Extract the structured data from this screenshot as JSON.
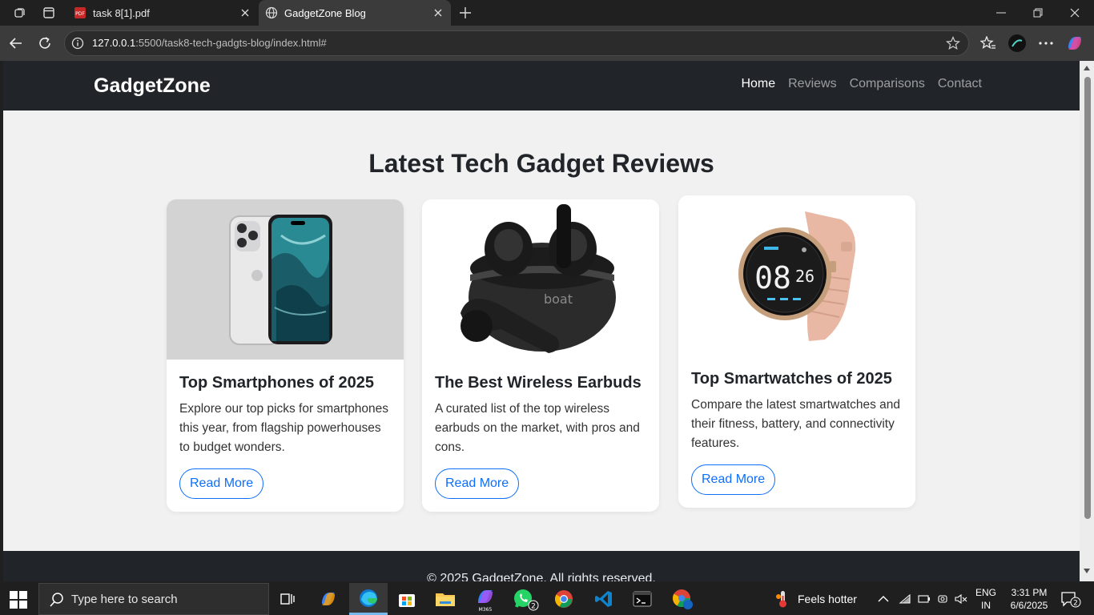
{
  "browser": {
    "tabs": [
      {
        "title": "task 8[1].pdf",
        "icon": "pdf-icon"
      },
      {
        "title": "GadgetZone Blog",
        "icon": "globe-icon",
        "active": true
      }
    ],
    "url": {
      "host": "127.0.0.1",
      "rest": ":5500/task8-tech-gadgts-blog/index.html#"
    }
  },
  "site": {
    "brand": "GadgetZone",
    "nav": [
      "Home",
      "Reviews",
      "Comparisons",
      "Contact"
    ],
    "heading": "Latest Tech Gadget Reviews",
    "cards": [
      {
        "title": "Top Smartphones of 2025",
        "text": "Explore our top picks for smartphones this year, from flagship powerhouses to budget wonders.",
        "button": "Read More"
      },
      {
        "title": "The Best Wireless Earbuds",
        "text": "A curated list of the top wireless earbuds on the market, with pros and cons.",
        "button": "Read More",
        "brand_mark": "boat"
      },
      {
        "title": "Top Smartwatches of 2025",
        "text": "Compare the latest smartwatches and their fitness, battery, and connectivity features.",
        "button": "Read More",
        "watch_time": "08",
        "watch_min": "26"
      }
    ],
    "footer": "© 2025 GadgetZone. All rights reserved."
  },
  "taskbar": {
    "search_placeholder": "Type here to search",
    "weather": "Feels hotter",
    "lang": "ENG",
    "region": "IN",
    "time": "3:31 PM",
    "date": "6/6/2025",
    "whatsapp_badge": "2",
    "notif_badge": "2",
    "m365_label": "M365"
  },
  "colors": {
    "accent": "#0d6efd",
    "nav_bg": "#212529",
    "page_bg": "#f1f1f1"
  }
}
